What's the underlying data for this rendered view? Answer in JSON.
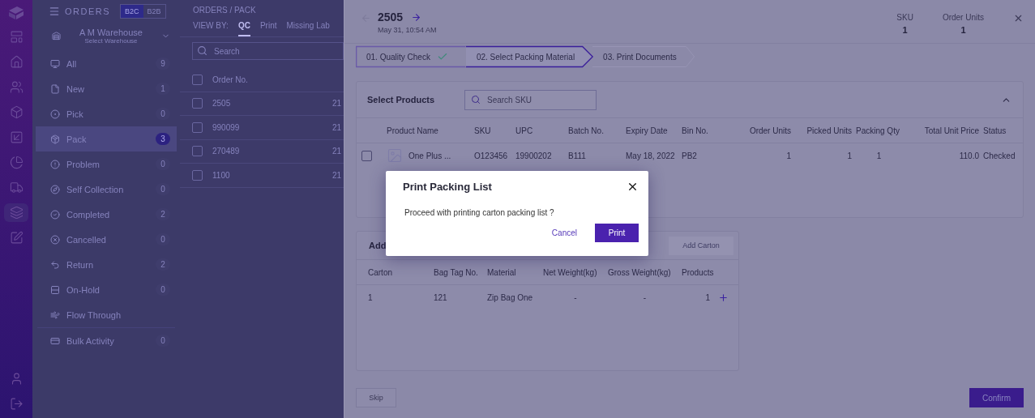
{
  "rail": {
    "items": [
      {
        "selected": false
      },
      {
        "selected": false
      },
      {
        "selected": false
      },
      {
        "selected": false
      },
      {
        "selected": false
      },
      {
        "selected": false
      },
      {
        "selected": false
      },
      {
        "selected": true
      },
      {
        "selected": false
      }
    ]
  },
  "sidebar": {
    "title": "ORDERS",
    "channel_tabs": [
      {
        "label": "B2C",
        "selected": true
      },
      {
        "label": "B2B",
        "selected": false
      }
    ],
    "warehouse": {
      "name": "A M Warehouse",
      "hint": "Select Warehouse"
    },
    "items": [
      {
        "label": "All",
        "count": "9",
        "selected": false
      },
      {
        "label": "New",
        "count": "1",
        "selected": false
      },
      {
        "label": "Pick",
        "count": "0",
        "selected": false
      },
      {
        "label": "Pack",
        "count": "3",
        "selected": true
      },
      {
        "label": "Problem",
        "count": "0",
        "selected": false
      },
      {
        "label": "Self Collection",
        "count": "0",
        "selected": false
      },
      {
        "label": "Completed",
        "count": "2",
        "selected": false
      },
      {
        "label": "Cancelled",
        "count": "0",
        "selected": false
      },
      {
        "label": "Return",
        "count": "2",
        "selected": false
      },
      {
        "label": "On-Hold",
        "count": "0",
        "selected": false
      },
      {
        "label": "Flow Through",
        "selected": false
      }
    ],
    "footer_items": [
      {
        "label": "Bulk Activity",
        "count": "0",
        "selected": false
      }
    ]
  },
  "orders_list": {
    "breadcrumb": "ORDERS / PACK",
    "view_by_label": "VIEW BY:",
    "view_tabs": [
      {
        "label": "QC",
        "selected": true
      },
      {
        "label": "Print",
        "selected": false
      },
      {
        "label": "Missing Lab",
        "selected": false
      }
    ],
    "search": {
      "placeholder": "Search"
    },
    "all_checked": false,
    "columns": [
      "Order No."
    ],
    "rows": [
      {
        "order_no": "2505",
        "column_2": "21",
        "checked": false
      },
      {
        "order_no": "990099",
        "column_2": "21",
        "checked": false
      },
      {
        "order_no": "270489",
        "column_2": "21",
        "checked": false
      },
      {
        "order_no": "1100",
        "column_2": "21",
        "checked": false
      }
    ]
  },
  "detail": {
    "order_no": "2505",
    "date": "May 31, 10:54 AM",
    "stats": [
      {
        "label": "SKU",
        "value": "1"
      },
      {
        "label": "Order Units",
        "value": "1"
      }
    ],
    "steps": [
      {
        "label": "01. Quality Check",
        "done": true,
        "selected": false
      },
      {
        "label": "02. Select Packing Material",
        "done": false,
        "selected": true
      },
      {
        "label": "03. Print Documents",
        "done": false,
        "selected": false
      }
    ],
    "products": {
      "title": "Select Products",
      "search": {
        "placeholder": "Search SKU"
      },
      "expanded": true,
      "columns": [
        "Product Name",
        "SKU",
        "UPC",
        "Batch No.",
        "Expiry Date",
        "Bin No.",
        "Order Units",
        "Picked Units",
        "Packing Qty",
        "Total Unit Price",
        "Status"
      ],
      "rows": [
        {
          "checked": false,
          "cells": [
            "One Plus ...",
            "O123456",
            "19900202",
            "B111",
            "May 18, 2022",
            "PB2",
            "1",
            "1",
            "1",
            "110.0",
            "Checked"
          ]
        }
      ]
    },
    "cartons": {
      "title": "Add",
      "add_button": {
        "label": "Add Carton",
        "disabled": true
      },
      "columns": [
        "Carton",
        "Bag Tag No.",
        "Material",
        "Net Weight(kg)",
        "Gross Weight(kg)",
        "Products"
      ],
      "rows": [
        {
          "cells": [
            "1",
            "121",
            "Zip Bag One",
            "-",
            "-",
            "1"
          ]
        }
      ]
    },
    "skip_button": "Skip",
    "confirm_button": "Confirm"
  },
  "dialog": {
    "title": "Print Packing List",
    "message": "Proceed with printing carton packing list ?",
    "buttons": [
      {
        "label": "Cancel",
        "kind": "text"
      },
      {
        "label": "Print",
        "kind": "primary"
      }
    ]
  }
}
